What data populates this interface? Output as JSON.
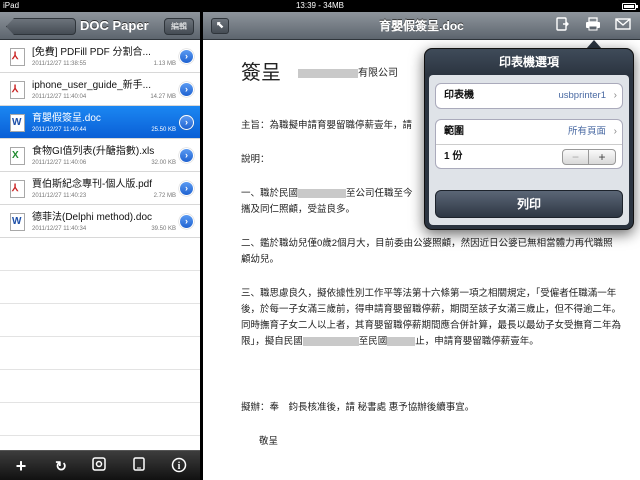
{
  "statusbar": {
    "device": "iPad",
    "info": "13:39 - 34MB"
  },
  "left": {
    "title": "DOC Paper",
    "edit_label": "編輯",
    "files": [
      {
        "name": "[免費] PDFill PDF 分割合...",
        "date": "2011/12/27 11:38:55",
        "size": "1.13 MB",
        "type": "pdf",
        "selected": false
      },
      {
        "name": "iphone_user_guide_新手...",
        "date": "2011/12/27 11:40:04",
        "size": "14.27 MB",
        "type": "pdf",
        "selected": false
      },
      {
        "name": "育嬰假簽呈.doc",
        "date": "2011/12/27 11:40:44",
        "size": "25.50 KB",
        "type": "doc",
        "selected": true
      },
      {
        "name": "食物GI值列表(升醣指數).xls",
        "date": "2011/12/27 11:40:06",
        "size": "32.00 KB",
        "type": "xls",
        "selected": false
      },
      {
        "name": "賈伯斯紀念專刊-個人版.pdf",
        "date": "2011/12/27 11:40:23",
        "size": "2.72 MB",
        "type": "pdf",
        "selected": false
      },
      {
        "name": "德菲法(Delphi method).doc",
        "date": "2011/12/27 11:40:34",
        "size": "39.50 KB",
        "type": "doc",
        "selected": false
      }
    ],
    "toolbar": {
      "add": "+",
      "refresh": "↻",
      "info": "i"
    }
  },
  "doc": {
    "title": "育嬰假簽呈.doc",
    "heading": "簽呈",
    "company_suffix": "有限公司",
    "p1": "主旨：為職擬申請育嬰留職停薪壹年，請",
    "p2": "說明：",
    "p3a": "一、職於民國",
    "p3b": "至公司任職至今",
    "p3c": "攜及同仁照顧，受益良多。",
    "p4": "二、鑑於職幼兒僅0歲2個月大，目前委由公婆照顧，然因近日公婆已無相當體力再代職照顧幼兒。",
    "p5a": "三、職思慮良久，擬依據性別工作平等法第十六條第一項之相關規定，「受僱者任職滿一年後，於每一子女滿三歲前，得申請育嬰留職停薪，期間至該子女滿三歲止，但不得逾二年。同時撫育子女二人以上者，其育嬰留職停薪期間應合併計算，最長以最幼子女受撫育二年為限」，擬自民國",
    "p5b": "至民國",
    "p5c": "止，申請育嬰留職停薪壹年。",
    "p6": "擬辦：奉　鈞長核准後，請 秘書處 惠予協辦後續事宜。",
    "p7": "敬呈"
  },
  "popover": {
    "title": "印表機選項",
    "printer_label": "印表機",
    "printer_value": "usbprinter1",
    "range_label": "範圍",
    "range_value": "所有頁面",
    "copies_label": "1 份",
    "minus": "−",
    "plus": "+",
    "print_label": "列印"
  }
}
